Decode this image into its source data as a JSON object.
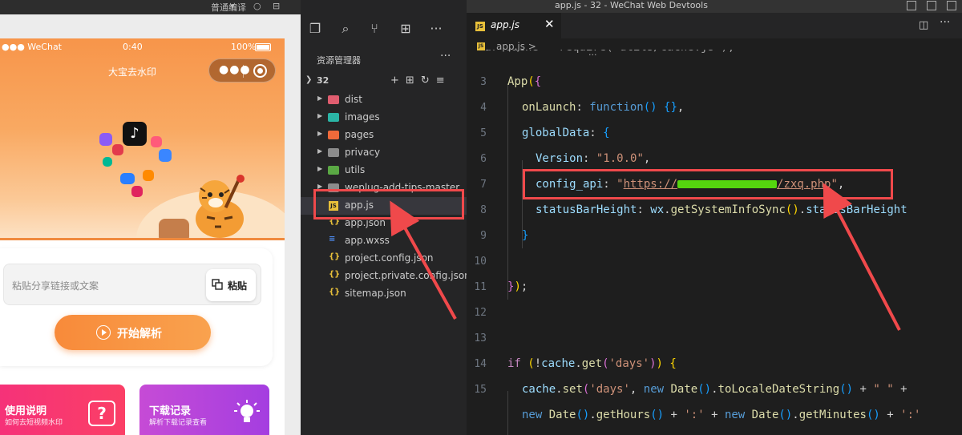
{
  "window": {
    "title": "app.js - 32 - WeChat Web Devtools",
    "compile_mode": "普通编译"
  },
  "simulator": {
    "status_bar": {
      "carrier": "●●● WeChat",
      "time": "0:40",
      "battery": "100%"
    },
    "app_title": "大宝去水印",
    "search": {
      "placeholder": "粘贴分享链接或文案",
      "paste_label": "粘贴"
    },
    "parse_button": "开始解析",
    "cards": [
      {
        "title": "使用说明",
        "subtitle": "如何去短视频水印"
      },
      {
        "title": "下载记录",
        "subtitle": "解析下载记录查看"
      }
    ],
    "colors": {
      "banner": "#f7954a",
      "accent": "#f88a3a",
      "card_usage": "#f5317a",
      "card_downloads": "#b244dc"
    }
  },
  "explorer": {
    "title": "资源管理器",
    "folder": "32",
    "items": [
      {
        "name": "dist",
        "type": "folder",
        "icon_color": "#e05d6f"
      },
      {
        "name": "images",
        "type": "folder",
        "icon_color": "#2bb5a6"
      },
      {
        "name": "pages",
        "type": "folder",
        "icon_color": "#f06a3a"
      },
      {
        "name": "privacy",
        "type": "folder",
        "icon_color": "#8c8c8c"
      },
      {
        "name": "utils",
        "type": "folder",
        "icon_color": "#5aa844"
      },
      {
        "name": "weplug-add-tips-master",
        "type": "folder",
        "icon_color": "#8c8c8c"
      },
      {
        "name": "app.js",
        "type": "js"
      },
      {
        "name": "app.json",
        "type": "json"
      },
      {
        "name": "app.wxss",
        "type": "css"
      },
      {
        "name": "project.config.json",
        "type": "json"
      },
      {
        "name": "project.private.config.json",
        "type": "json"
      },
      {
        "name": "sitemap.json",
        "type": "json"
      }
    ]
  },
  "editor": {
    "tab": "app.js",
    "breadcrumb": "app.js >",
    "lines": [
      {
        "n": "",
        "text": "var cache = require('utils/cache.js');"
      },
      {
        "n": "3",
        "text": "App({"
      },
      {
        "n": "4",
        "text": "onLaunch: function() {},"
      },
      {
        "n": "5",
        "text": "globalData: {"
      },
      {
        "n": "6",
        "text": "Version: \"1.0.0\","
      },
      {
        "n": "7",
        "text_prefix": "config_api: \"",
        "url_start": "https://",
        "url_end": "/zxq.php",
        "text_suffix": "\","
      },
      {
        "n": "8",
        "text": "statusBarHeight: wx.getSystemInfoSync().statusBarHeight"
      },
      {
        "n": "9",
        "text": "}"
      },
      {
        "n": "10",
        "text": ""
      },
      {
        "n": "11",
        "text": "});"
      },
      {
        "n": "12",
        "text": ""
      },
      {
        "n": "13",
        "text": ""
      },
      {
        "n": "14",
        "text": "if (!cache.get('days')) {"
      },
      {
        "n": "15",
        "text": "cache.set('days', new Date().toLocaleDateString() + \" \" +"
      },
      {
        "n": "",
        "text": "new Date().getHours() + ':' + new Date().getMinutes() + ':'"
      }
    ]
  }
}
